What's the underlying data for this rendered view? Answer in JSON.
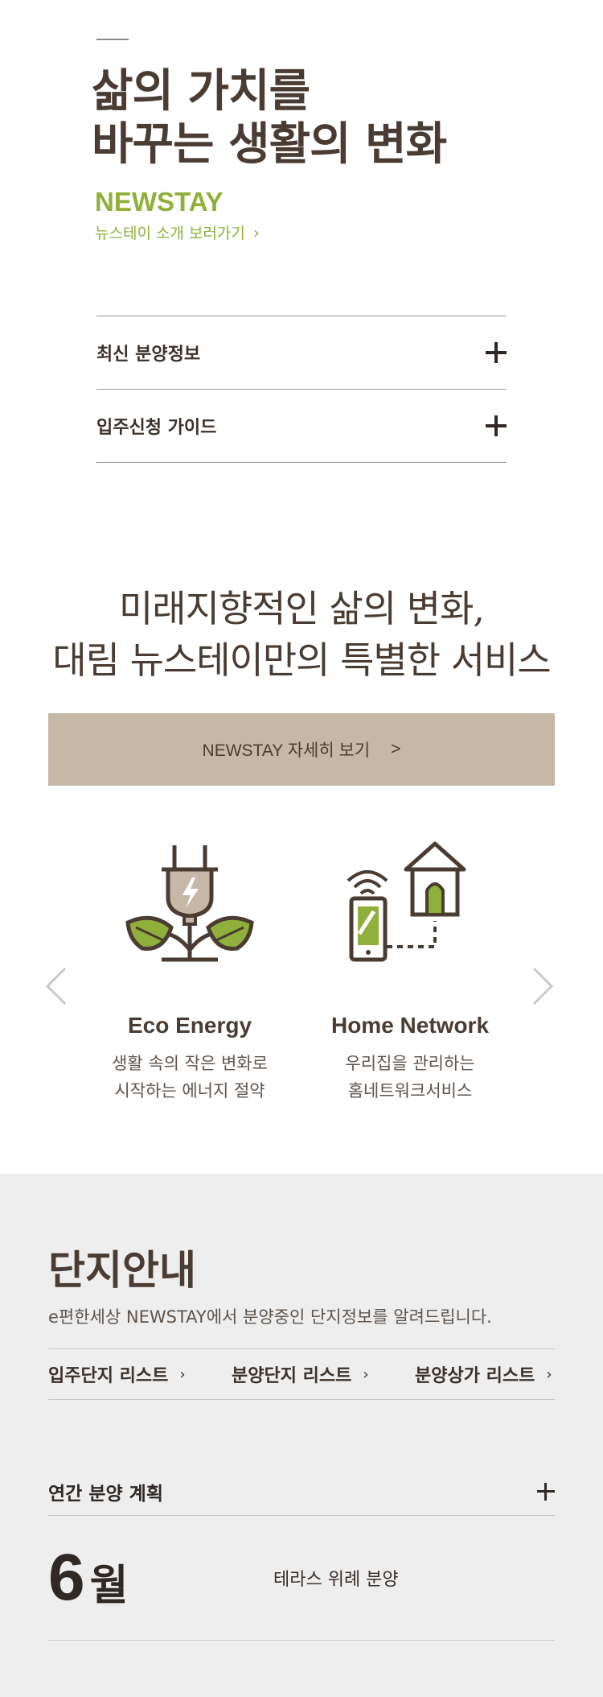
{
  "hero": {
    "title_line1": "삶의 가치를",
    "title_line2": "바꾸는 생활의 변화",
    "brand": "NEWSTAY",
    "brand_link": "뉴스테이 소개 보러가기",
    "chevron": "›"
  },
  "accordion": {
    "items": [
      {
        "label": "최신 분양정보"
      },
      {
        "label": "입주신청 가이드"
      }
    ]
  },
  "services_section": {
    "title_line1": "미래지향적인 삶의 변화,",
    "title_line2": "대림 뉴스테이만의 특별한 서비스",
    "button_label": "NEWSTAY 자세히 보기",
    "button_chevron": ">",
    "items": [
      {
        "name": "Eco Energy",
        "desc_line1": "생활 속의 작은 변화로",
        "desc_line2": "시작하는 에너지 절약",
        "icon": "eco-energy-icon"
      },
      {
        "name": "Home Network",
        "desc_line1": "우리집을 관리하는",
        "desc_line2": "홈네트워크서비스",
        "icon": "home-network-icon"
      }
    ]
  },
  "complex": {
    "title": "단지안내",
    "subtitle": "e편한세상 NEWSTAY에서 분양중인 단지정보를 알려드립니다.",
    "tabs": [
      {
        "label": "입주단지 리스트"
      },
      {
        "label": "분양단지 리스트"
      },
      {
        "label": "분양상가 리스트"
      }
    ],
    "tab_chevron": "›",
    "plan": {
      "label": "연간 분양 계획",
      "month_num": "6",
      "month_unit": "월",
      "text": "테라스 위례 분양"
    }
  },
  "colors": {
    "brand_green": "#8fb03a",
    "brown_text": "#4a3c32",
    "button_beige": "#c6b8a6",
    "gray_bg": "#eeeeee"
  }
}
